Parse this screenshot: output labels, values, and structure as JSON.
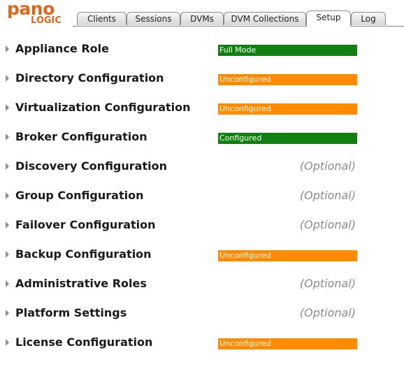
{
  "logo": {
    "line1": "pano",
    "line2": "LOGIC"
  },
  "tabs": [
    {
      "label": "Clients"
    },
    {
      "label": "Sessions"
    },
    {
      "label": "DVMs"
    },
    {
      "label": "DVM Collections"
    },
    {
      "label": "Setup",
      "active": true
    },
    {
      "label": "Log"
    }
  ],
  "colors": {
    "configured": "#118011",
    "unconfigured": "#ff8c00",
    "optional": "#8a8a8a",
    "brand": "#e0661a"
  },
  "rows": [
    {
      "label": "Appliance Role",
      "status": "Full Mode",
      "kind": "green"
    },
    {
      "label": "Directory Configuration",
      "status": "Unconfigured",
      "kind": "orange"
    },
    {
      "label": "Virtualization Configuration",
      "status": "Unconfigured",
      "kind": "orange"
    },
    {
      "label": "Broker Configuration",
      "status": "Configured",
      "kind": "green"
    },
    {
      "label": "Discovery Configuration",
      "status": "(Optional)",
      "kind": "optional"
    },
    {
      "label": "Group Configuration",
      "status": "(Optional)",
      "kind": "optional"
    },
    {
      "label": "Failover Configuration",
      "status": "(Optional)",
      "kind": "optional"
    },
    {
      "label": "Backup Configuration",
      "status": "Unconfigured",
      "kind": "orange"
    },
    {
      "label": "Administrative Roles",
      "status": "(Optional)",
      "kind": "optional"
    },
    {
      "label": "Platform Settings",
      "status": "(Optional)",
      "kind": "optional"
    },
    {
      "label": "License Configuration",
      "status": "Unconfigured",
      "kind": "orange"
    }
  ]
}
